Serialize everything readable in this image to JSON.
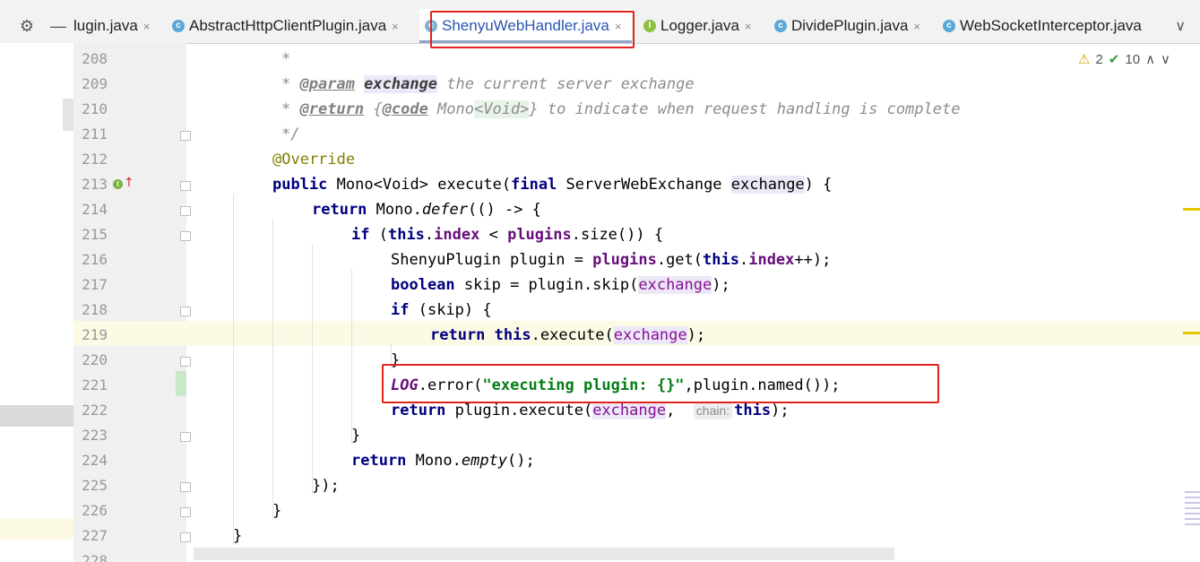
{
  "tabs": {
    "items": [
      {
        "label": "lugin.java",
        "icon": "none",
        "active": false
      },
      {
        "label": "AbstractHttpClientPlugin.java",
        "icon": "class-icon",
        "active": false
      },
      {
        "label": "ShenyuWebHandler.java",
        "icon": "class-icon",
        "active": true
      },
      {
        "label": "Logger.java",
        "icon": "interface-icon",
        "active": false
      },
      {
        "label": "DividePlugin.java",
        "icon": "class-icon",
        "active": false
      },
      {
        "label": "WebSocketInterceptor.java",
        "icon": "class-icon",
        "active": false
      }
    ],
    "close_glyph": "×",
    "more_glyph": "∨",
    "settings_glyph": "⚙",
    "dash_glyph": "—"
  },
  "inspections": {
    "warnings": "2",
    "ok": "10",
    "warn_glyph": "⚠",
    "ok_glyph": "✔"
  },
  "hint_chain": "chain:",
  "line_numbers": [
    "208",
    "209",
    "210",
    "211",
    "212",
    "213",
    "214",
    "215",
    "216",
    "217",
    "218",
    "219",
    "220",
    "221",
    "222",
    "223",
    "224",
    "225",
    "226",
    "227",
    "228"
  ],
  "code": {
    "l208": "*",
    "l209_star": "* ",
    "l209_tag": "@param",
    "l209_name": "exchange",
    "l209_text": " the current server exchange",
    "l210_star": "* ",
    "l210_tag": "@return",
    "l210_open": " {",
    "l210_code": "@code",
    "l210_mono": " Mono",
    "l210_generic": "<Void>",
    "l210_text": "} to indicate when request handling is complete",
    "l211": "*/",
    "l212": "@Override",
    "l213_public": "public",
    "l213_a": " Mono<Void> execute(",
    "l213_final": "final",
    "l213_b": " ServerWebExchange ",
    "l213_param": "exchange",
    "l213_c": ") {",
    "l214_return": "return",
    "l214_a": " Mono.",
    "l214_defer": "defer",
    "l214_b": "(() -> {",
    "l215_if": "if",
    "l215_a": " (",
    "l215_this": "this",
    "l215_b": ".",
    "l215_index": "index",
    "l215_c": " < ",
    "l215_plugins": "plugins",
    "l215_d": ".size()) {",
    "l216_a": "ShenyuPlugin plugin = ",
    "l216_plugins": "plugins",
    "l216_b": ".get(",
    "l216_this": "this",
    "l216_c": ".",
    "l216_index": "index",
    "l216_d": "++);",
    "l217_bool": "boolean",
    "l217_a": " skip = plugin.skip(",
    "l217_param": "exchange",
    "l217_b": ");",
    "l218_if": "if",
    "l218_a": " (skip) {",
    "l219_return": "return",
    "l219_a": " ",
    "l219_this": "this",
    "l219_b": ".execute(",
    "l219_param": "exchange",
    "l219_c": ");",
    "l220": "}",
    "l221_log": "LOG",
    "l221_a": ".error(",
    "l221_str": "\"executing plugin: {}\"",
    "l221_b": ",plugin.named());",
    "l222_return": "return",
    "l222_a": " plugin.execute(",
    "l222_param": "exchange",
    "l222_b": ",  ",
    "l222_this": "this",
    "l222_c": ");",
    "l223": "}",
    "l224_return": "return",
    "l224_a": " Mono.",
    "l224_empty": "empty",
    "l224_b": "();",
    "l225": "});",
    "l226": "}",
    "l227": "}"
  }
}
